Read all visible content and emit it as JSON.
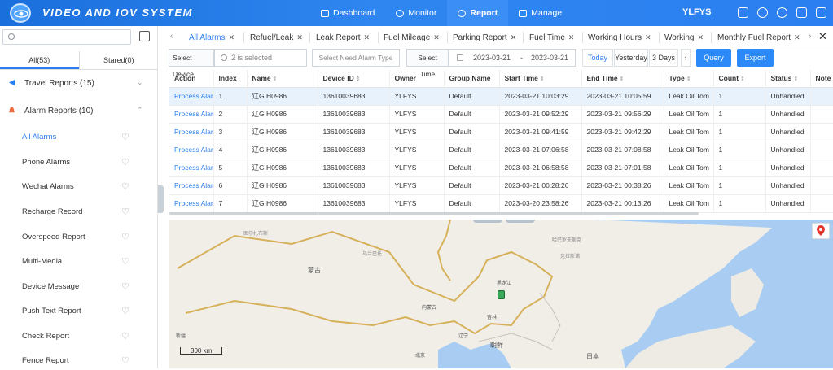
{
  "app": {
    "title": "VIDEO AND IOV SYSTEM",
    "user": "YLFYS"
  },
  "nav": [
    {
      "label": "Dashboard",
      "icon": "dashboard-icon"
    },
    {
      "label": "Monitor",
      "icon": "location-icon"
    },
    {
      "label": "Report",
      "icon": "report-icon",
      "active": true
    },
    {
      "label": "Manage",
      "icon": "grid-icon"
    }
  ],
  "top_icons": [
    "message-icon",
    "settings-icon",
    "headset-icon",
    "fullscreen-icon",
    "logout-icon"
  ],
  "sidebar": {
    "search_placeholder": "",
    "tabs": [
      {
        "label": "All(53)",
        "active": true
      },
      {
        "label": "Stared(0)"
      }
    ],
    "groups": [
      {
        "label": "Travel Reports",
        "count": "(15)",
        "icon": "travel-icon",
        "color": "#2b7ff0",
        "expanded": false
      },
      {
        "label": "Alarm Reports",
        "count": "(10)",
        "icon": "alarm-icon",
        "color": "#f26b3a",
        "expanded": true
      }
    ],
    "items": [
      {
        "label": "All Alarms",
        "active": true
      },
      {
        "label": "Phone Alarms"
      },
      {
        "label": "Wechat Alarms"
      },
      {
        "label": "Recharge Record"
      },
      {
        "label": "Overspeed Report"
      },
      {
        "label": "Multi-Media"
      },
      {
        "label": "Device Message"
      },
      {
        "label": "Push Text Report"
      },
      {
        "label": "Check Report"
      },
      {
        "label": "Fence Report"
      }
    ]
  },
  "tabs": [
    {
      "label": "All Alarms",
      "active": true
    },
    {
      "label": "Refuel/Leak"
    },
    {
      "label": "Leak Report"
    },
    {
      "label": "Fuel Mileage"
    },
    {
      "label": "Parking Report"
    },
    {
      "label": "Fuel Time"
    },
    {
      "label": "Working Hours"
    },
    {
      "label": "Working"
    },
    {
      "label": "Monthly Fuel Report"
    }
  ],
  "toolbar": {
    "select_device_label": "Select Device",
    "device_value": "2 is selected",
    "alarm_type_placeholder": "Select Need Alarm Type",
    "select_time_label": "Select Time",
    "date_start": "2023-03-21",
    "date_sep": "-",
    "date_end": "2023-03-21",
    "today": "Today",
    "yesterday": "Yesterday",
    "three_days": "3 Days",
    "query": "Query",
    "export": "Export"
  },
  "table": {
    "columns": [
      "Action",
      "Index",
      "Name",
      "Device ID",
      "Owner",
      "Group Name",
      "Start Time",
      "End Time",
      "Type",
      "Count",
      "Status",
      "Note"
    ],
    "rows": [
      [
        "Process Alarm",
        "1",
        "辽G H0986",
        "13610039683",
        "YLFYS",
        "Default",
        "2023-03-21 10:03:29",
        "2023-03-21 10:05:59",
        "Leak Oil Tom",
        "1",
        "Unhandled",
        ""
      ],
      [
        "Process Alarm",
        "2",
        "辽G H0986",
        "13610039683",
        "YLFYS",
        "Default",
        "2023-03-21 09:52:29",
        "2023-03-21 09:56:29",
        "Leak Oil Tom",
        "1",
        "Unhandled",
        ""
      ],
      [
        "Process Alarm",
        "3",
        "辽G H0986",
        "13610039683",
        "YLFYS",
        "Default",
        "2023-03-21 09:41:59",
        "2023-03-21 09:42:29",
        "Leak Oil Tom",
        "1",
        "Unhandled",
        ""
      ],
      [
        "Process Alarm",
        "4",
        "辽G H0986",
        "13610039683",
        "YLFYS",
        "Default",
        "2023-03-21 07:06:58",
        "2023-03-21 07:08:58",
        "Leak Oil Tom",
        "1",
        "Unhandled",
        ""
      ],
      [
        "Process Alarm",
        "5",
        "辽G H0986",
        "13610039683",
        "YLFYS",
        "Default",
        "2023-03-21 06:58:58",
        "2023-03-21 07:01:58",
        "Leak Oil Tom",
        "1",
        "Unhandled",
        ""
      ],
      [
        "Process Alarm",
        "6",
        "辽G H0986",
        "13610039683",
        "YLFYS",
        "Default",
        "2023-03-21 00:28:26",
        "2023-03-21 00:38:26",
        "Leak Oil Tom",
        "1",
        "Unhandled",
        ""
      ],
      [
        "Process Alarm",
        "7",
        "辽G H0986",
        "13610039683",
        "YLFYS",
        "Default",
        "2023-03-20 23:58:26",
        "2023-03-21 00:13:26",
        "Leak Oil Tom",
        "1",
        "Unhandled",
        ""
      ]
    ]
  },
  "map": {
    "labels": {
      "mongolia": "蒙古",
      "heilongjiang": "黑龙江",
      "jilin": "吉林",
      "neimenggu": "内蒙古",
      "liaoning": "辽宁",
      "korea": "朝鲜",
      "japan": "日本",
      "xinjiang": "新疆",
      "beijing": "北京"
    },
    "small_labels": {
      "a": "图尔扎布斯",
      "b": "哈巴罗夫斯克",
      "c": "克拉斯诺",
      "d": "乌兰巴托"
    },
    "scale": "300 km",
    "colors": {
      "land": "#f1eee8",
      "sea": "#a9cdf2",
      "border": "#d6b15a"
    }
  }
}
